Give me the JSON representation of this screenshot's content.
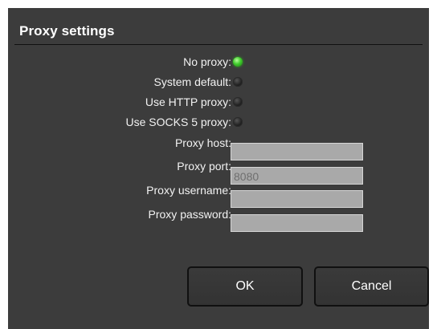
{
  "dialog": {
    "title": "Proxy settings"
  },
  "proxy_mode": {
    "options": [
      {
        "label": "No proxy:",
        "selected": true
      },
      {
        "label": "System default:",
        "selected": false
      },
      {
        "label": "Use HTTP proxy:",
        "selected": false
      },
      {
        "label": "Use SOCKS 5 proxy:",
        "selected": false
      }
    ],
    "selected_color": "#3fcc2c"
  },
  "fields": {
    "host": {
      "label": "Proxy host:",
      "value": "",
      "placeholder": ""
    },
    "port": {
      "label": "Proxy port:",
      "value": "",
      "placeholder": "8080"
    },
    "username": {
      "label": "Proxy username:",
      "value": "",
      "placeholder": ""
    },
    "password": {
      "label": "Proxy password:",
      "value": "",
      "placeholder": ""
    }
  },
  "buttons": {
    "ok_label": "OK",
    "cancel_label": "Cancel"
  }
}
